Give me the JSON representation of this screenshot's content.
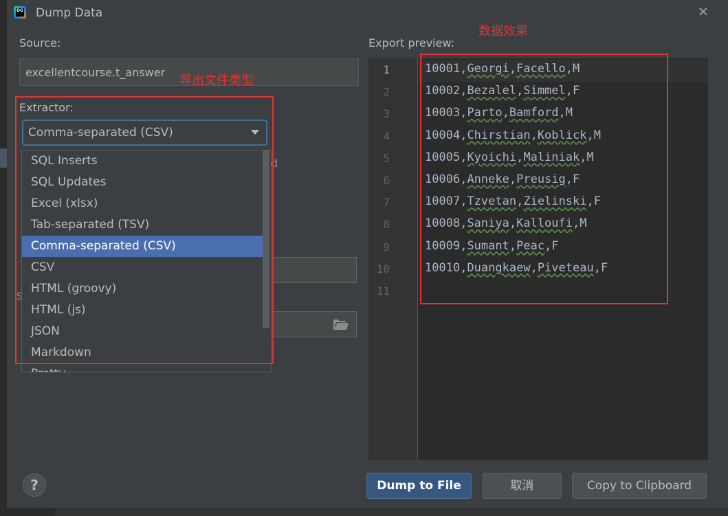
{
  "window": {
    "title": "Dump Data",
    "app_icon_text": "DG",
    "close_glyph": "✕"
  },
  "source": {
    "label": "Source:",
    "value": "excellentcourse.t_answer"
  },
  "extractor": {
    "label": "Extractor:",
    "selected": "Comma-separated (CSV)",
    "options": [
      "SQL Inserts",
      "SQL Updates",
      "Excel (xlsx)",
      "Tab-separated (TSV)",
      "Comma-separated (CSV)",
      "CSV",
      "HTML (groovy)",
      "HTML (js)",
      "JSON",
      "Markdown",
      "Pretty"
    ]
  },
  "background_partial_text": {
    "d": "d",
    "s": "S"
  },
  "preview": {
    "label": "Export preview:",
    "line_numbers": [
      "1",
      "2",
      "3",
      "4",
      "5",
      "6",
      "7",
      "8",
      "9",
      "10",
      "11"
    ],
    "rows": [
      [
        "10001",
        "Georgi",
        "Facello",
        "M"
      ],
      [
        "10002",
        "Bezalel",
        "Simmel",
        "F"
      ],
      [
        "10003",
        "Parto",
        "Bamford",
        "M"
      ],
      [
        "10004",
        "Chirstian",
        "Koblick",
        "M"
      ],
      [
        "10005",
        "Kyoichi",
        "Maliniak",
        "M"
      ],
      [
        "10006",
        "Anneke",
        "Preusig",
        "F"
      ],
      [
        "10007",
        "Tzvetan",
        "Zielinski",
        "F"
      ],
      [
        "10008",
        "Saniya",
        "Kalloufi",
        "M"
      ],
      [
        "10009",
        "Sumant",
        "Peac",
        "F"
      ],
      [
        "10010",
        "Duangkaew",
        "Piveteau",
        "F"
      ]
    ]
  },
  "buttons": {
    "help": "?",
    "dump_to_file": "Dump to File",
    "cancel": "取消",
    "copy_to_clipboard": "Copy to Clipboard"
  },
  "annotations": {
    "export_type": "导出文件类型",
    "data_effect": "数据效果",
    "color": "#e8312f"
  },
  "icons": {
    "app": "datagrip-icon",
    "close": "close-icon",
    "dropdown": "chevron-down-icon",
    "folder": "folder-icon",
    "help": "help-icon"
  },
  "colors": {
    "selected_item": "#4b6eaf",
    "primary_button": "#365880",
    "focus_border": "#466d94",
    "code_text": "#a9b7c6"
  }
}
